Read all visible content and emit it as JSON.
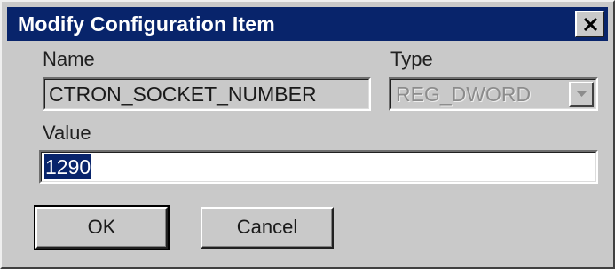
{
  "window": {
    "title": "Modify Configuration Item",
    "close_icon": "close-icon"
  },
  "form": {
    "name_label": "Name",
    "name_value": "CTRON_SOCKET_NUMBER",
    "type_label": "Type",
    "type_value": "REG_DWORD",
    "type_dropdown_icon": "chevron-down-icon",
    "value_label": "Value",
    "value_value": "1290"
  },
  "buttons": {
    "ok_label": "OK",
    "cancel_label": "Cancel"
  }
}
